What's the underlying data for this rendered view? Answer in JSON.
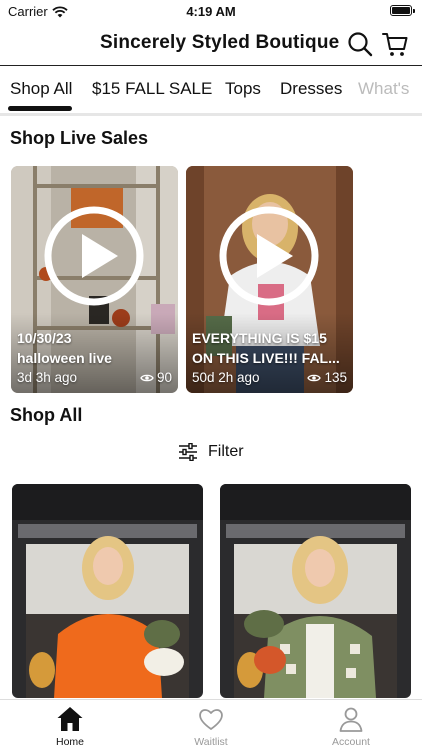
{
  "status_bar": {
    "carrier": "Carrier",
    "time": "4:19 AM"
  },
  "header": {
    "title": "Sincerely Styled Boutique",
    "icons": [
      "search-icon",
      "cart-icon"
    ]
  },
  "tabs": [
    {
      "label": "Shop All",
      "active": true
    },
    {
      "label": "$15 FALL SALE",
      "active": false
    },
    {
      "label": "Tops",
      "active": false
    },
    {
      "label": "Dresses",
      "active": false
    },
    {
      "label": "What's",
      "active": false
    }
  ],
  "live_section": {
    "title": "Shop Live Sales",
    "cards": [
      {
        "line1": "10/30/23",
        "line2": "halloween live",
        "ago": "3d 3h ago",
        "views": "90"
      },
      {
        "line1": "EVERYTHING IS $15",
        "line2": "ON THIS LIVE!!! FAL...",
        "ago": "50d 2h ago",
        "views": "135"
      }
    ]
  },
  "shop_all": {
    "title": "Shop All",
    "filter_label": "Filter"
  },
  "bottom_nav": [
    {
      "label": "Home",
      "icon": "home-icon",
      "active": true
    },
    {
      "label": "Waitlist",
      "icon": "heart-icon",
      "active": false
    },
    {
      "label": "Account",
      "icon": "user-icon",
      "active": false
    }
  ],
  "colors": {
    "text": "#111111",
    "inactive": "#999999",
    "divider": "#e6e6e6"
  }
}
